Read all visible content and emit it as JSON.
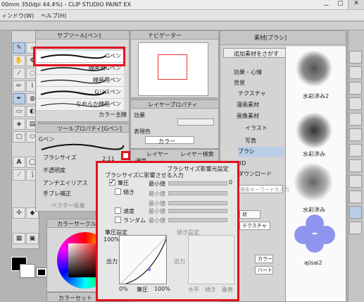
{
  "window": {
    "title": "00mm 350dpi 44.4%) - CLIP STUDIO PAINT EX",
    "minimize": "－",
    "restore": "▢",
    "close": "✕"
  },
  "menu": {
    "items": [
      "ィンドウ(W)",
      "ヘルプ(H)"
    ]
  },
  "subtool_panel": {
    "tab": "サブツール[ペン]",
    "brushes": [
      "Gペン",
      "線画用Gペン",
      "線画用ペン",
      "Gリスペン",
      "なめらか線画ペン"
    ],
    "footer": "カラー主線"
  },
  "tool_property": {
    "tab": "ツールプロパティ[Gペン]",
    "brush_name": "Gペン",
    "brush_size_label": "ブラシサイズ",
    "brush_size_value": "2.11",
    "opacity_label": "不透明度",
    "antialias_label": "アンチエイリアス",
    "stabilization_label": "手ブレ補正",
    "vector_label": "ベクター吸着"
  },
  "navigator": {
    "tab": "ナビゲーター"
  },
  "layer_property": {
    "tab": "レイヤープロパティ",
    "effect_label": "効果",
    "color_label": "表現色",
    "color_value": "カラー"
  },
  "layer_panel": {
    "tab": "レイヤー",
    "tab2": "レイヤー検索",
    "blend": "通常"
  },
  "color_panel": {
    "tab": "カラーサークル",
    "tab2": "カラーセット"
  },
  "material_panel": {
    "tab": "素材[ブラシ]",
    "add_button": "追加素材をさがす",
    "tree": [
      "効果・心情",
      "背景",
      "テクスチャ",
      "漫画素材",
      "画像素材",
      "イラスト",
      "写真",
      "ブラシ",
      "3D",
      "ダウンロード"
    ],
    "search_placeholder": "検索キーワードを入力",
    "tags": [
      "状",
      "テクスチャ",
      "カラー",
      "ハート"
    ],
    "items": [
      "水彩滲み2",
      "水彩滲み",
      "水彩滲み",
      "ajisai2"
    ]
  },
  "pressure_popup": {
    "title": "ブラシサイズ影響元設定",
    "subtitle": "ブラシサイズに影響させる入力",
    "inputs": [
      {
        "label": "筆圧",
        "checked": true,
        "min_label": "最小値",
        "min_value": "0"
      },
      {
        "label": "傾き",
        "checked": false,
        "min_label": "最小値",
        "min_value": ""
      },
      {
        "label": "",
        "checked": false,
        "min_label": "最小値",
        "min_value": ""
      },
      {
        "label": "速度",
        "checked": false,
        "min_label": "最小値",
        "min_value": ""
      },
      {
        "label": "ランダム",
        "checked": false,
        "min_label": "最小値",
        "min_value": ""
      }
    ],
    "pressure_settings": "筆圧設定",
    "tilt_settings": "傾き設定",
    "graph": {
      "y_top": "100%",
      "y_label": "出力",
      "x_start": "0%",
      "x_label": "筆圧",
      "x_end": "100%"
    },
    "tilt_graph": {
      "y_label": "出力",
      "x_labels": [
        "水平",
        "傾き",
        "垂直"
      ]
    }
  },
  "colors": {
    "accent_red": "#e0141e",
    "selection": "#b9cde6",
    "bloom": "#8f95ef"
  }
}
